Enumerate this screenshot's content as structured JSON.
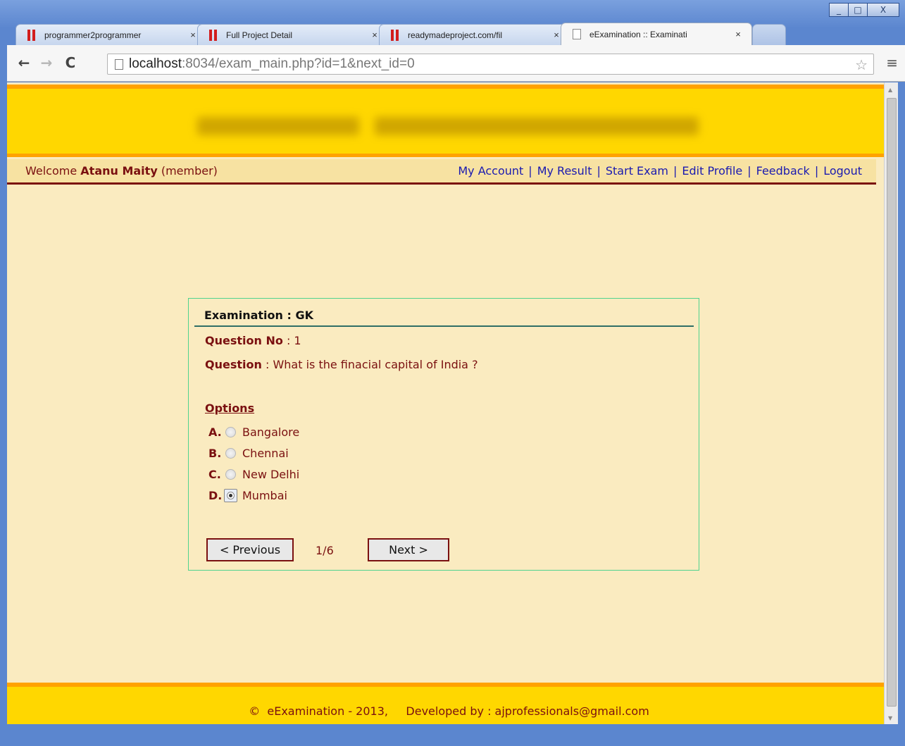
{
  "browser": {
    "tabs": [
      {
        "title": "programmer2programmer",
        "icon": "red-bars-icon"
      },
      {
        "title": "Full Project Detail",
        "icon": "red-bars-icon"
      },
      {
        "title": "readymadeproject.com/fil",
        "icon": "red-bars-icon"
      },
      {
        "title": "eExamination :: Examinati",
        "icon": "page-icon",
        "active": true
      }
    ],
    "close_glyph": "×",
    "url_host": "localhost",
    "url_rest": ":8034/exam_main.php?id=1&next_id=0",
    "window_controls": [
      "_",
      "□",
      "X"
    ]
  },
  "nav": {
    "welcome_prefix": "Welcome",
    "user_name": "Atanu Maity",
    "role": "(member)",
    "links": [
      "My Account",
      "My Result",
      "Start Exam",
      "Edit Profile",
      "Feedback",
      "Logout"
    ],
    "separator": "|"
  },
  "exam": {
    "title": "Examination : GK",
    "question_no_label": "Question No",
    "question_no": ": 1",
    "question_label": "Question",
    "question_text": ": What is the finacial capital of India ?",
    "options_heading": "Options",
    "options": [
      {
        "letter": "A.",
        "text": "Bangalore",
        "selected": false
      },
      {
        "letter": "B.",
        "text": "Chennai",
        "selected": false
      },
      {
        "letter": "C.",
        "text": "New Delhi",
        "selected": false
      },
      {
        "letter": "D.",
        "text": "Mumbai",
        "selected": true
      }
    ],
    "prev_label": "< Previous",
    "next_label": "Next >",
    "page_count": "1/6"
  },
  "footer": {
    "text": "©  eExamination - 2013,     Developed by : ajprofessionals@gmail.com"
  },
  "colors": {
    "header_yellow": "#ffd700",
    "header_orange": "#ffa200",
    "page_bg": "#faebc0",
    "maroon": "#7a1010",
    "link_blue": "#1a1ab0",
    "box_border": "#4fd38e"
  }
}
